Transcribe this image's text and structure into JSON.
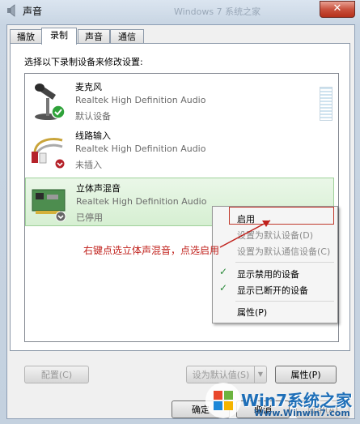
{
  "window": {
    "title": "声音",
    "close_glyph": "✕",
    "background_title": "Windows 7 系统之家"
  },
  "tabs": [
    "播放",
    "录制",
    "声音",
    "通信"
  ],
  "active_tab": "录制",
  "prompt": "选择以下录制设备来修改设置:",
  "devices": [
    {
      "name": "麦克风",
      "driver": "Realtek High Definition Audio",
      "status": "默认设备",
      "icon": "microphone-icon",
      "badge": "check-badge-icon"
    },
    {
      "name": "线路输入",
      "driver": "Realtek High Definition Audio",
      "status": "未插入",
      "icon": "line-in-cable-icon",
      "badge": "unplugged-badge-icon"
    },
    {
      "name": "立体声混音",
      "driver": "Realtek High Definition Audio",
      "status": "已停用",
      "icon": "sound-card-icon",
      "badge": "disabled-badge-icon"
    }
  ],
  "context_menu": {
    "items": [
      {
        "label": "启用",
        "disabled": false,
        "checked": false
      },
      {
        "label": "设置为默认设备(D)",
        "disabled": true,
        "checked": false
      },
      {
        "label": "设置为默认通信设备(C)",
        "disabled": true,
        "checked": false
      },
      {
        "label": "显示禁用的设备",
        "disabled": false,
        "checked": true
      },
      {
        "label": "显示已断开的设备",
        "disabled": false,
        "checked": true
      },
      {
        "label": "属性(P)",
        "disabled": false,
        "checked": false
      }
    ]
  },
  "annotation": "右键点选立体声混音，点选启用",
  "buttons": {
    "configure": "配置(C)",
    "set_default": "设为默认值(S)",
    "properties": "属性(P)",
    "ok": "确定",
    "cancel": "取消",
    "apply": "应用(A)"
  },
  "watermark": {
    "brand": "Win7系统之家",
    "url": "Www.Winwin7.com"
  },
  "colors": {
    "selection": "#d6efd2",
    "annotation": "#c0201b",
    "close": "#c9523e",
    "watermark": "#1e6fb8"
  }
}
